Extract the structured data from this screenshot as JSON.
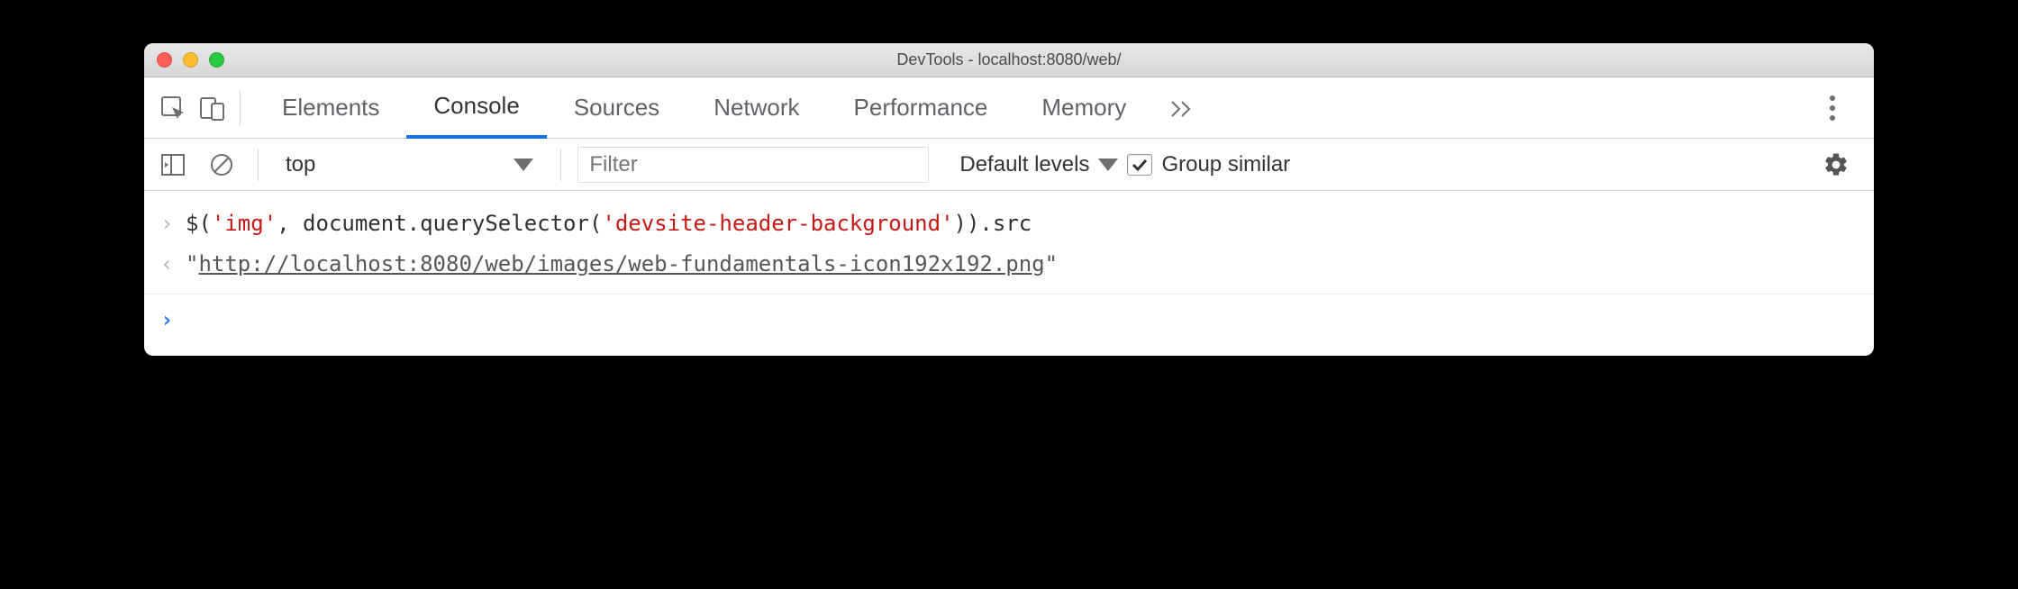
{
  "window": {
    "title": "DevTools - localhost:8080/web/"
  },
  "tabs": {
    "items": [
      "Elements",
      "Console",
      "Sources",
      "Network",
      "Performance",
      "Memory"
    ],
    "active": "Console"
  },
  "toolbar": {
    "context": "top",
    "filter_placeholder": "Filter",
    "levels_label": "Default levels",
    "group_checked": true,
    "group_label": "Group similar"
  },
  "console": {
    "input_prefix": "$(",
    "str1": "'img'",
    "mid": ", document.querySelector(",
    "str2": "'devsite-header-background'",
    "suffix": ")).src",
    "output_url": "http://localhost:8080/web/images/web-fundamentals-icon192x192.png"
  }
}
